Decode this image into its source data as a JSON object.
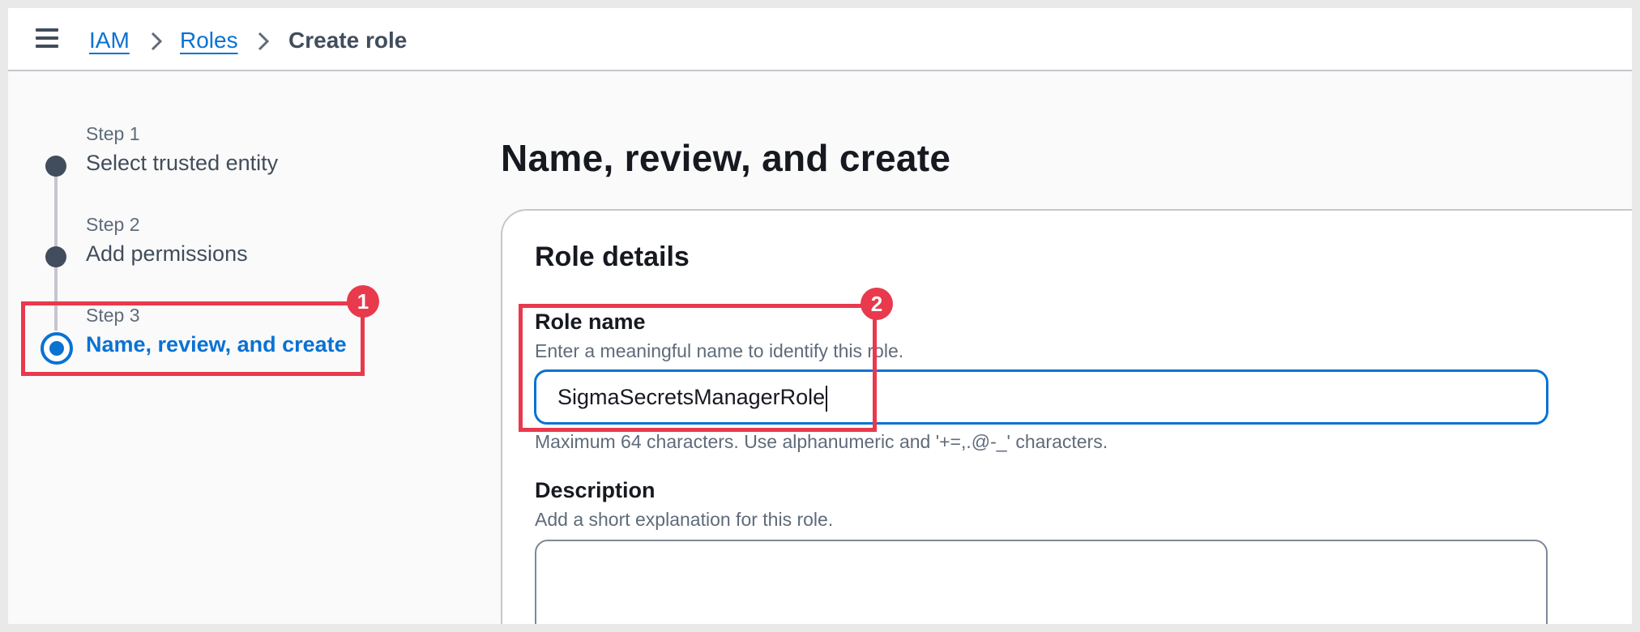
{
  "breadcrumb": {
    "items": [
      "IAM",
      "Roles"
    ],
    "current": "Create role"
  },
  "steps": [
    {
      "label": "Step 1",
      "title": "Select trusted entity"
    },
    {
      "label": "Step 2",
      "title": "Add permissions"
    },
    {
      "label": "Step 3",
      "title": "Name, review, and create"
    }
  ],
  "page": {
    "title": "Name, review, and create"
  },
  "role_details": {
    "title": "Role details",
    "role_name": {
      "label": "Role name",
      "description": "Enter a meaningful name to identify this role.",
      "value": "SigmaSecretsManagerRole",
      "constraint": "Maximum 64 characters. Use alphanumeric and '+=,.@-_' characters."
    },
    "description": {
      "label": "Description",
      "description": "Add a short explanation for this role.",
      "value": ""
    }
  },
  "annotations": [
    "1",
    "2"
  ],
  "colors": {
    "link": "#0972d3",
    "annotation": "#e8394d",
    "text": "#16191f",
    "muted": "#5f6b7a"
  }
}
